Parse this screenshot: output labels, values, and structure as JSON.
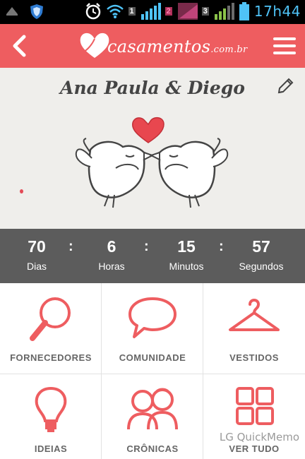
{
  "status_bar": {
    "time": "17h44",
    "sim2": "2",
    "sim1": "1",
    "sim3": "3",
    "icons": [
      "notification-icon",
      "shield-icon",
      "alarm-icon",
      "wifi-icon",
      "signal-icon",
      "battery-icon"
    ]
  },
  "header": {
    "logo_main": "casamentos",
    "logo_suffix": ".com.br",
    "brand_color": "#ee5d60"
  },
  "hero": {
    "couple_names": "Ana Paula & Diego"
  },
  "countdown": {
    "days": {
      "value": "70",
      "label": "Dias"
    },
    "hours": {
      "value": "6",
      "label": "Horas"
    },
    "minutes": {
      "value": "15",
      "label": "Minutos"
    },
    "seconds": {
      "value": "57",
      "label": "Segundos"
    },
    "separator": ":"
  },
  "grid": {
    "items": [
      {
        "label": "FORNECEDORES",
        "icon": "magnifier-icon"
      },
      {
        "label": "COMUNIDADE",
        "icon": "speech-bubble-icon"
      },
      {
        "label": "VESTIDOS",
        "icon": "hanger-icon"
      },
      {
        "label": "IDEIAS",
        "icon": "lightbulb-icon"
      },
      {
        "label": "CRÔNICAS",
        "icon": "couple-icon"
      },
      {
        "label": "VER TUDO",
        "icon": "grid-icon"
      }
    ]
  },
  "watermark": "LG QuickMemo"
}
